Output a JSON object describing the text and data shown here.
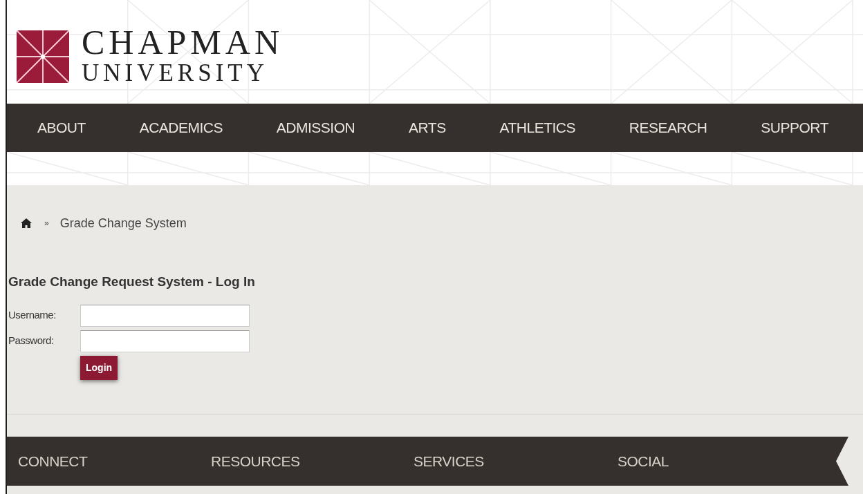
{
  "logo": {
    "line_1": "CHAPMAN",
    "line_2": "UNIVERSITY"
  },
  "nav": [
    {
      "label": "ABOUT"
    },
    {
      "label": "ACADEMICS"
    },
    {
      "label": "ADMISSION"
    },
    {
      "label": "ARTS"
    },
    {
      "label": "ATHLETICS"
    },
    {
      "label": "RESEARCH"
    },
    {
      "label": "SUPPORT"
    }
  ],
  "breadcrumb": {
    "separator": "»",
    "current": "Grade Change System"
  },
  "heading": "Grade Change Request System - Log In",
  "fields": [
    {
      "label": "Username:"
    },
    {
      "label": "Password:"
    }
  ],
  "login_button": "Login",
  "footer": [
    {
      "label": "CONNECT"
    },
    {
      "label": "RESOURCES"
    },
    {
      "label": "SERVICES"
    },
    {
      "label": "SOCIAL"
    }
  ]
}
